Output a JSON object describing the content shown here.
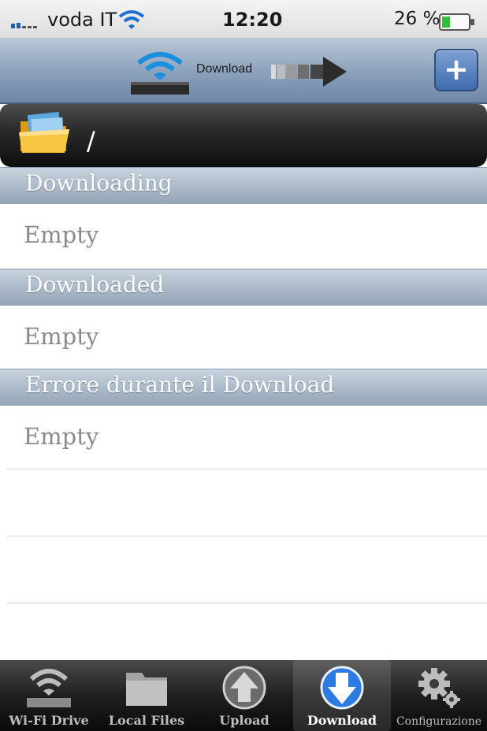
{
  "status_bar": {
    "carrier": "voda IT",
    "time": "12:20",
    "battery_percent": "26 %"
  },
  "nav": {
    "title_text": "Download",
    "add_button_label": "+"
  },
  "path": {
    "current": "/"
  },
  "sections": [
    {
      "title": "Downloading",
      "empty_label": "Empty"
    },
    {
      "title": "Downloaded",
      "empty_label": "Empty"
    },
    {
      "title": "Errore durante il Download",
      "empty_label": "Empty"
    }
  ],
  "tabs": [
    {
      "label": "Wi-Fi Drive",
      "icon": "wifi-drive-icon"
    },
    {
      "label": "Local Files",
      "icon": "folder-icon"
    },
    {
      "label": "Upload",
      "icon": "upload-arrow-icon"
    },
    {
      "label": "Download",
      "icon": "download-arrow-icon",
      "selected": true
    },
    {
      "label": "Configurazione",
      "icon": "gears-icon"
    }
  ],
  "colors": {
    "nav_accent": "#3e6bac",
    "section_header": "#aab8c7",
    "selected_tab_icon": "#2d7be0"
  }
}
